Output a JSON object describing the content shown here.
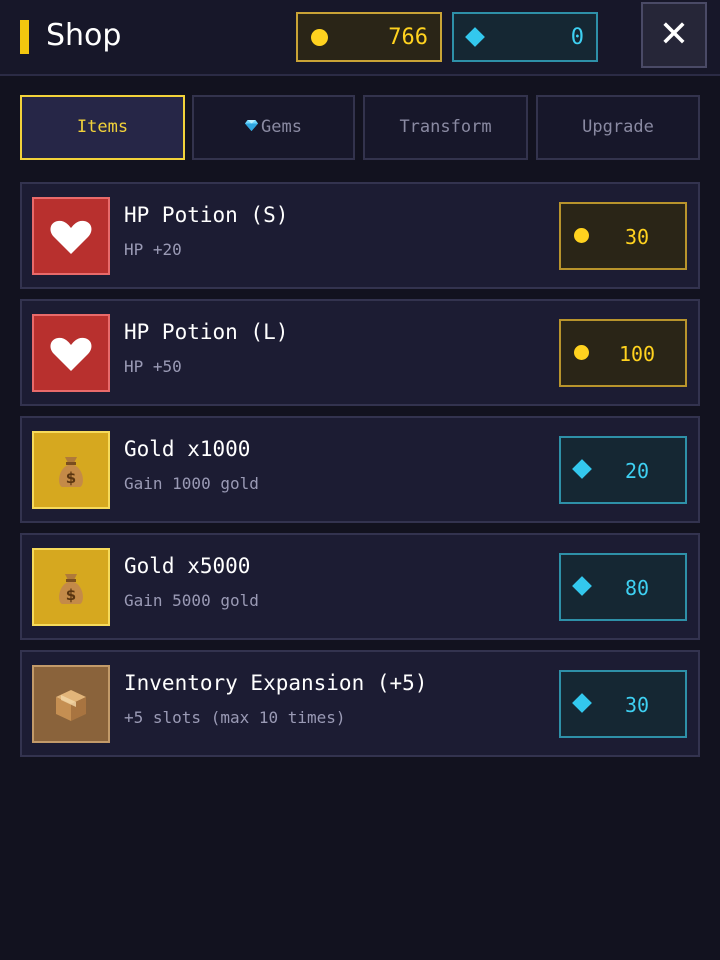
{
  "header": {
    "title": "Shop",
    "gold_amount": "766",
    "gem_amount": "0",
    "close_label": "✕"
  },
  "tabs": [
    {
      "label": "Items",
      "active": true
    },
    {
      "label": "Gems",
      "active": false,
      "icon": "gem-icon"
    },
    {
      "label": "Transform",
      "active": false
    },
    {
      "label": "Upgrade",
      "active": false
    }
  ],
  "items": [
    {
      "name": "HP Potion (S)",
      "description": "HP +20",
      "icon": "heart-icon",
      "price": "30",
      "currency": "gold"
    },
    {
      "name": "HP Potion (L)",
      "description": "HP +50",
      "icon": "heart-icon",
      "price": "100",
      "currency": "gold"
    },
    {
      "name": "Gold x1000",
      "description": "Gain 1000 gold",
      "icon": "money-bag-icon",
      "price": "20",
      "currency": "gem"
    },
    {
      "name": "Gold x5000",
      "description": "Gain 5000 gold",
      "icon": "money-bag-icon",
      "price": "80",
      "currency": "gem"
    },
    {
      "name": "Inventory Expansion (+5)",
      "description": "+5 slots (max 10 times)",
      "icon": "box-icon",
      "price": "30",
      "currency": "gem"
    }
  ],
  "colors": {
    "background": "#12121f",
    "accent_yellow": "#f2d23a",
    "gold": "#ffd21f",
    "gem": "#33c8ee",
    "heart_tile": "#b8302e",
    "gold_tile": "#d6a81f",
    "box_tile": "#8a633b"
  }
}
